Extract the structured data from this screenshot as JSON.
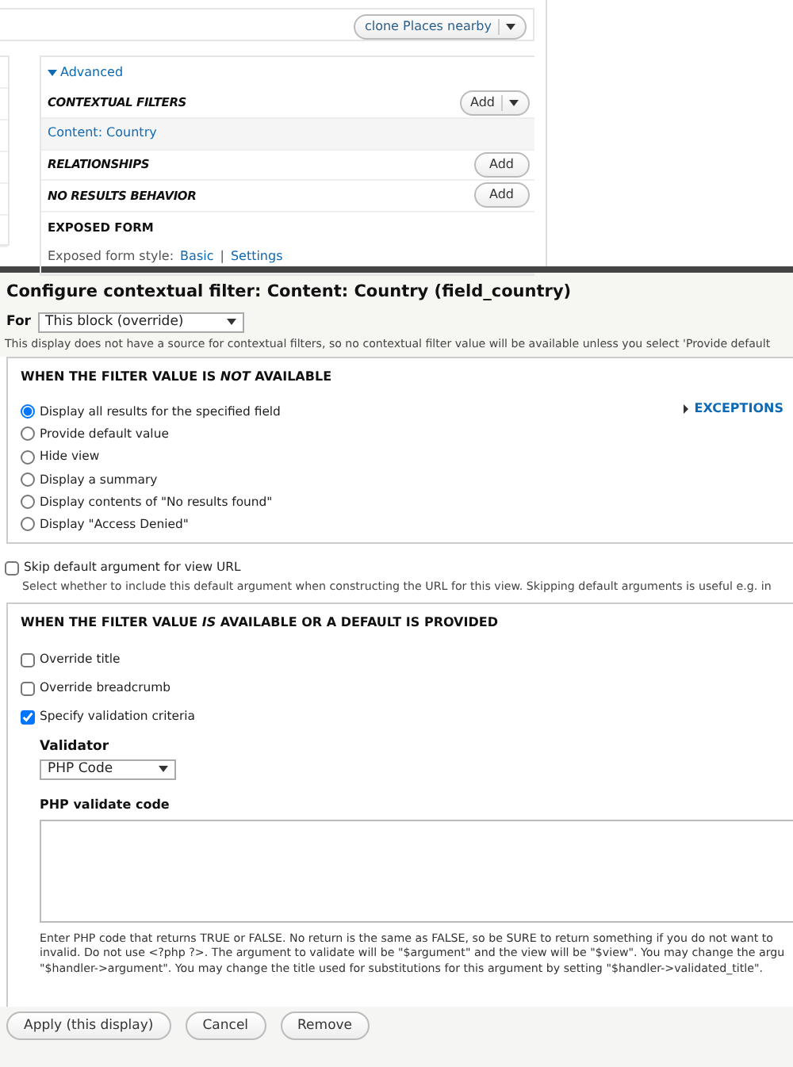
{
  "top": {
    "display_button": {
      "label": "clone Places nearby"
    }
  },
  "advanced": {
    "toggle": "Advanced",
    "expanded": true,
    "sections": [
      {
        "title": "CONTEXTUAL FILTERS",
        "kind": "dropbutton",
        "button": "Add",
        "items": [
          "Content: Country"
        ]
      },
      {
        "title": "RELATIONSHIPS",
        "kind": "button",
        "button": "Add"
      },
      {
        "title": "NO RESULTS BEHAVIOR",
        "kind": "button",
        "button": "Add"
      }
    ],
    "exposed_form": {
      "title": "EXPOSED FORM",
      "label": "Exposed form style:",
      "links": [
        "Basic",
        "Settings"
      ],
      "separator": "|"
    }
  },
  "dialog": {
    "title": "Configure contextual filter: Content: Country (field_country)",
    "for_label": "For",
    "for_value": "This block (override)",
    "notice": "This display does not have a source for contextual filters, so no contextual filter value will be available unless you select 'Provide default",
    "not_available": {
      "heading": "WHEN THE FILTER VALUE IS *NOT* AVAILABLE",
      "options": [
        {
          "label": "Display all results for the specified field",
          "selected": true
        },
        {
          "label": "Provide default value",
          "selected": false
        },
        {
          "label": "Hide view",
          "selected": false
        },
        {
          "label": "Display a summary",
          "selected": false
        },
        {
          "label": "Display contents of \"No results found\"",
          "selected": false
        },
        {
          "label": "Display \"Access Denied\"",
          "selected": false
        }
      ],
      "exceptions": {
        "label": "EXCEPTIONS",
        "expanded": false
      }
    },
    "skip": {
      "label": "Skip default argument for view URL",
      "checked": false,
      "description": "Select whether to include this default argument when constructing the URL for this view. Skipping default arguments is useful e.g. in"
    },
    "available": {
      "heading": "WHEN THE FILTER VALUE *IS* AVAILABLE OR A DEFAULT IS PROVIDED",
      "checkboxes": [
        {
          "label": "Override title",
          "checked": false
        },
        {
          "label": "Override breadcrumb",
          "checked": false
        },
        {
          "label": "Specify validation criteria",
          "checked": true
        }
      ],
      "validator_label": "Validator",
      "validator_value": "PHP Code",
      "code_label": "PHP validate code",
      "help_lines": [
        "Enter PHP code that returns TRUE or FALSE. No return is the same as FALSE, so be SURE to return something if you do not want to",
        "invalid. Do not use <?php ?>. The argument to validate will be \"$argument\" and the view will be \"$view\". You may change the argu",
        "\"$handler->argument\". You may change the title used for substitutions for this argument by setting \"$handler->validated_title\"."
      ]
    },
    "buttons": [
      "Apply (this display)",
      "Cancel",
      "Remove"
    ]
  }
}
